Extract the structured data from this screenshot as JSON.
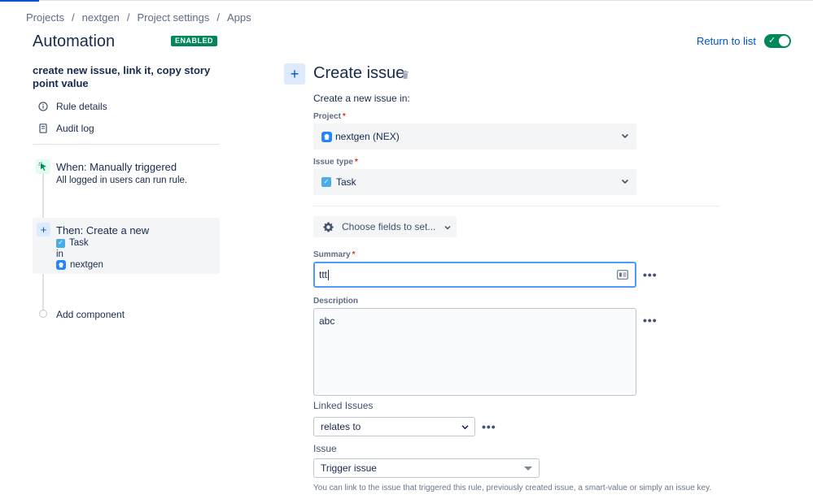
{
  "breadcrumb": {
    "items": [
      "Projects",
      "nextgen",
      "Project settings",
      "Apps"
    ],
    "separator": "/"
  },
  "header": {
    "title": "Automation",
    "status_badge": "ENABLED",
    "return_link": "Return to list",
    "toggle_on": true
  },
  "sidebar": {
    "rule_name": "create new issue, link it, copy story point value",
    "links": {
      "rule_details": "Rule details",
      "audit_log": "Audit log"
    },
    "trigger": {
      "title": "When: Manually triggered",
      "description": "All logged in users can run rule."
    },
    "action": {
      "title": "Then: Create a new",
      "issue_type": "Task",
      "connector": "in",
      "project": "nextgen"
    },
    "add_component": "Add component"
  },
  "form": {
    "title": "Create issue",
    "subtitle": "Create a new issue in:",
    "project": {
      "label": "Project",
      "required_mark": "*",
      "value": "nextgen (NEX)"
    },
    "issue_type": {
      "label": "Issue type",
      "required_mark": "*",
      "value": "Task"
    },
    "choose_fields": "Choose fields to set...",
    "summary": {
      "label": "Summary",
      "required_mark": "*",
      "value": "ttt"
    },
    "description": {
      "label": "Description",
      "value": "abc"
    },
    "linked_issues": {
      "label": "Linked Issues",
      "value": "relates to"
    },
    "issue": {
      "label": "Issue",
      "value": "Trigger issue",
      "help": "You can link to the issue that triggered this rule, previously created issue, a smart-value or simply an issue key."
    },
    "more_label": "•••"
  },
  "colors": {
    "accent": "#0052cc",
    "enabled_green": "#00875a",
    "focus_border": "#4c9aff",
    "required": "#de350b"
  },
  "icons": {
    "rule_details": "info-icon",
    "audit_log": "document-icon",
    "trigger": "cursor-click-icon",
    "action": "plus-icon",
    "delete": "trash-icon",
    "choose_fields": "gear-icon",
    "summary_format": "text-format-icon"
  }
}
